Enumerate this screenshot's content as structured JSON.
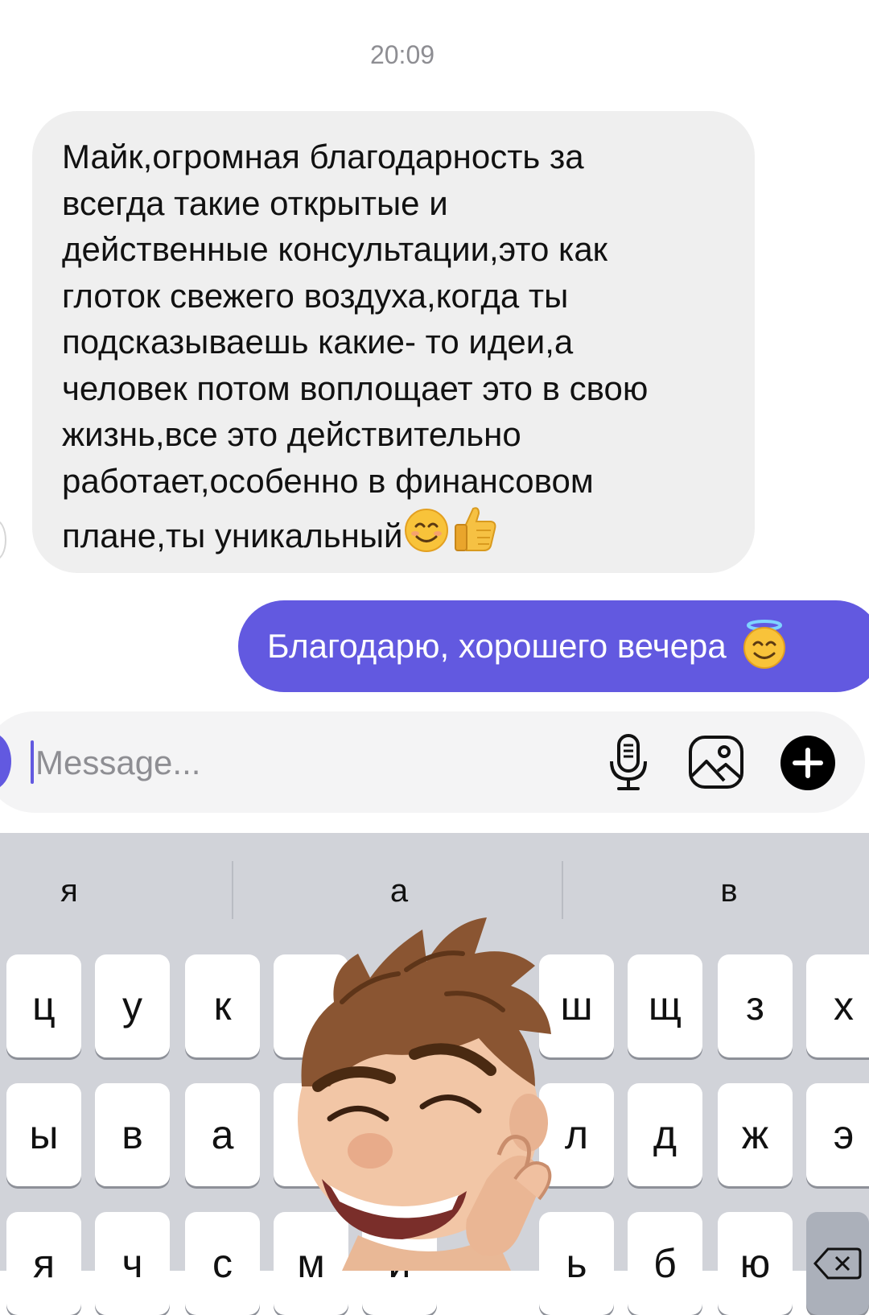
{
  "chat": {
    "timestamp": "20:09",
    "incoming": {
      "text": "Майк,огромная благодарность за\nвсегда такие открытые и\nдейственные консультации,это как\nглоток свежего воздуха,когда ты\nподсказываешь какие- то идеи,а\nчеловек потом воплощает это в свою\nжизнь,все это действительно\nработает,особенно в финансовом\nплане,ты уникальный",
      "emojis": [
        "smiling-face-emoji",
        "thumbs-up-emoji"
      ]
    },
    "outgoing": {
      "text": "Благодарю, хорошего вечера",
      "emoji": "halo-face-emoji",
      "color": "#6259e0"
    }
  },
  "composer": {
    "placeholder": "Message...",
    "icons": [
      "microphone-icon",
      "image-icon",
      "plus-icon"
    ]
  },
  "keyboard": {
    "suggestions": [
      "я",
      "а",
      "в"
    ],
    "row1": [
      "ц",
      "у",
      "к",
      "",
      "",
      "",
      "ш",
      "щ",
      "з",
      "х"
    ],
    "row2": [
      "ы",
      "в",
      "а",
      "",
      "",
      "",
      "л",
      "д",
      "ж",
      "э"
    ],
    "row3": [
      "я",
      "ч",
      "с",
      "м",
      "и",
      "",
      "ь",
      "б",
      "ю",
      ""
    ]
  },
  "overlay": {
    "sticker": "memoji-sticker"
  }
}
